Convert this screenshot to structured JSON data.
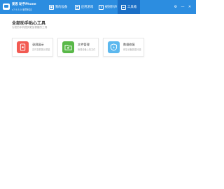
{
  "header": {
    "app_title": "爱思 助手Phone",
    "app_subtitle": "v7.9.5.0 爱思科技",
    "tabs": [
      {
        "label": "我的设备",
        "icon": "device-icon",
        "active": false
      },
      {
        "label": "应用游戏",
        "icon": "app-icon",
        "active": false
      },
      {
        "label": "视频铃声",
        "icon": "video-icon",
        "active": false
      },
      {
        "label": "工具箱",
        "icon": "toolbox-icon",
        "active": true
      }
    ],
    "window_controls": {
      "settings_glyph": "⚙",
      "minimize_glyph": "—",
      "close_glyph": "✕"
    }
  },
  "main": {
    "title": "全部助手贴心工具",
    "subtitle": "为您的手机提供更加便捷的工具",
    "tools": [
      {
        "title": "录屏展示",
        "desc": "实时录屏展示屏幕",
        "icon": "screen-record-icon",
        "color": "#f25a52"
      },
      {
        "title": "文件管理",
        "desc": "管理设备上的文件",
        "icon": "folder-icon",
        "color": "#59b848"
      },
      {
        "title": "数据修复",
        "desc": "修复设备数据问题",
        "icon": "shield-icon",
        "color": "#5cb8ee"
      }
    ]
  },
  "colors": {
    "header_bg": "#2c8de0",
    "active_tab_bg": "#1b6fc6"
  }
}
